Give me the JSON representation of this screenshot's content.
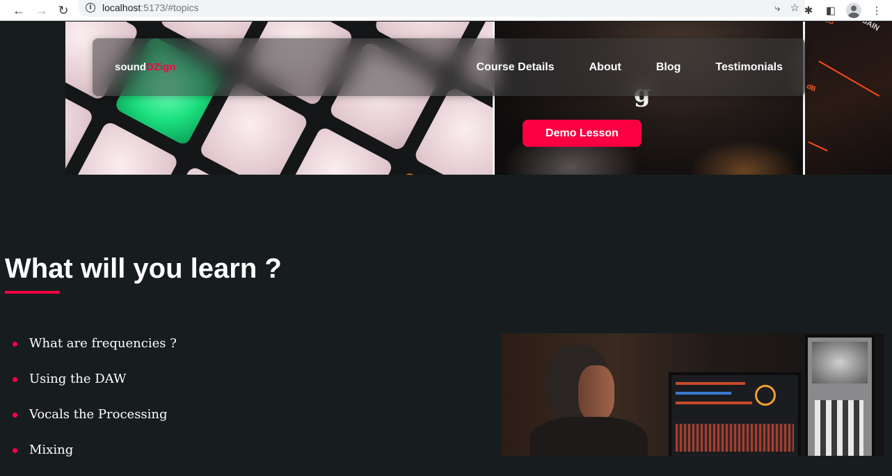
{
  "browser": {
    "url_host": "localhost",
    "url_rest": ":5173/#topics"
  },
  "navbar": {
    "logo_main": "sound",
    "logo_accent": "DZign",
    "links": [
      "Course Details",
      "About",
      "Blog",
      "Testimonials"
    ]
  },
  "hero": {
    "heading_fragment": "g",
    "demo_button": "Demo Lesson",
    "far_labels": [
      "dB",
      "GAIN",
      "dB"
    ]
  },
  "topics": {
    "title": "What will you learn ?",
    "items": [
      "What are frequencies ?",
      "Using the DAW",
      "Vocals the Processing",
      "Mixing"
    ]
  },
  "colors": {
    "accent": "#fa0042",
    "background": "#171d1f",
    "text": "#ffffff"
  }
}
